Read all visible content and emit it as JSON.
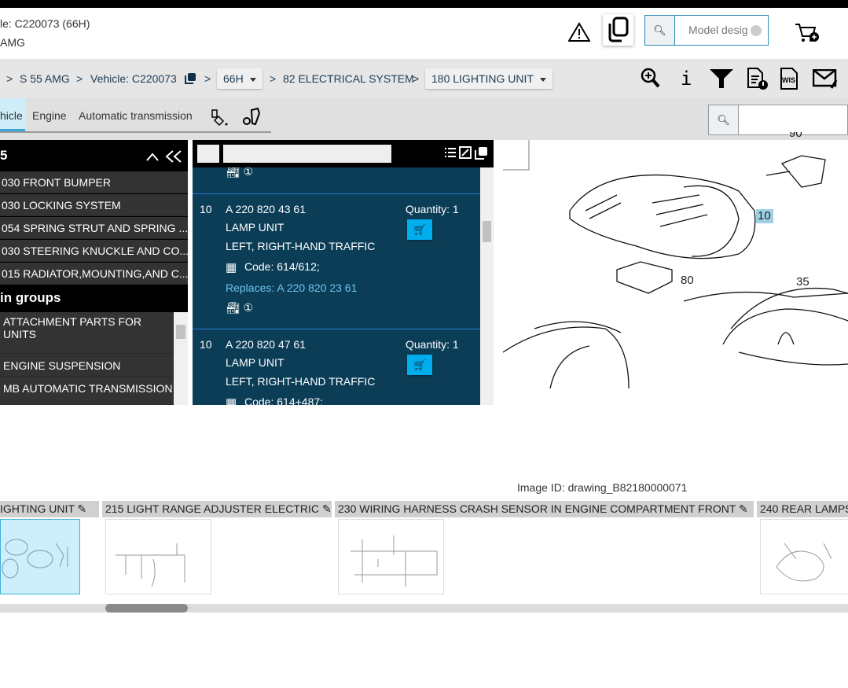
{
  "header": {
    "vehicle_line": "le: C220073 (66H)",
    "model_line": "AMG",
    "search_placeholder": "Model desig"
  },
  "breadcrumb": {
    "items": [
      "S 55 AMG",
      "Vehicle: C220073"
    ],
    "variant": "66H",
    "group": "82 ELECTRICAL SYSTEM",
    "subgroup": "180 LIGHTING UNIT",
    "sep": ">"
  },
  "tabs": [
    {
      "label": "hicle",
      "active": true
    },
    {
      "label": "Engine"
    },
    {
      "label": "Automatic transmission"
    }
  ],
  "left": {
    "title": "5",
    "recent": [
      "030 FRONT BUMPER",
      "030 LOCKING SYSTEM",
      "054 SPRING STRUT AND SPRING ...",
      "030 STEERING KNUCKLE AND CO...",
      "015 RADIATOR,MOUNTING,AND C..."
    ],
    "groups_title": "in groups",
    "groups": [
      "ATTACHMENT PARTS FOR UNITS",
      "ENGINE SUSPENSION",
      "MB AUTOMATIC TRANSMISSION"
    ]
  },
  "parts": [
    {
      "pos": "10",
      "number": "A 220 820 43 61",
      "name": "LAMP UNIT",
      "desc": "LEFT, RIGHT-HAND TRAFFIC",
      "code": "Code: 614/612;",
      "replaces": "Replaces: A 220 820 23 61",
      "quantity": "Quantity: 1"
    },
    {
      "pos": "10",
      "number": "A 220 820 47 61",
      "name": "LAMP UNIT",
      "desc": "LEFT, RIGHT-HAND TRAFFIC",
      "code": "Code: 614+487;",
      "quantity": "Quantity: 1"
    }
  ],
  "drawing": {
    "callouts": [
      "10",
      "80",
      "35",
      "90"
    ],
    "highlighted": "10",
    "image_id": "Image ID: drawing_B82180000071"
  },
  "thumbnails": [
    "IGHTING UNIT",
    "215 LIGHT RANGE ADJUSTER ELECTRIC",
    "230 WIRING HARNESS CRASH SENSOR IN ENGINE COMPARTMENT FRONT",
    "240 REAR LAMPS"
  ],
  "colors": {
    "panel_blue": "#0b3d57",
    "cart_button": "#00adef",
    "highlight": "#9fd0e4"
  }
}
